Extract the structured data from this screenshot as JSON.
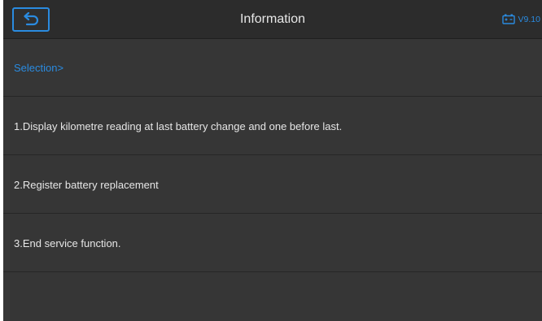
{
  "header": {
    "title": "Information",
    "version": "V9.10",
    "back_icon": "return-arrow-icon",
    "battery_icon": "battery-icon"
  },
  "menu": {
    "selection_label": "Selection>",
    "items": [
      {
        "label": "1.Display kilometre reading at last battery change and one before last."
      },
      {
        "label": "2.Register battery replacement"
      },
      {
        "label": "3.End service function."
      }
    ]
  },
  "colors": {
    "accent": "#2a8be0",
    "background": "#363636",
    "header": "#2c2c2c",
    "text": "#e6e6e6"
  }
}
